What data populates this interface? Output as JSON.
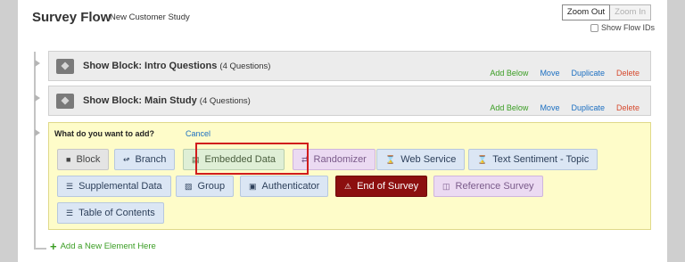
{
  "header": {
    "title": "Survey Flow",
    "subtitle": "New Customer Study",
    "zoom_out": "Zoom Out",
    "zoom_in": "Zoom In",
    "show_flow_ids": "Show Flow IDs"
  },
  "blocks": [
    {
      "label": "Show Block: Intro Questions",
      "count": "(4 Questions)"
    },
    {
      "label": "Show Block: Main Study",
      "count": "(4 Questions)"
    }
  ],
  "block_actions": {
    "add_below": "Add Below",
    "move": "Move",
    "duplicate": "Duplicate",
    "delete": "Delete"
  },
  "add_panel": {
    "question": "What do you want to add?",
    "cancel": "Cancel",
    "options": [
      {
        "label": "Block",
        "icon": "cube-icon"
      },
      {
        "label": "Branch",
        "icon": "branch-icon"
      },
      {
        "label": "Embedded Data",
        "icon": "data-icon"
      },
      {
        "label": "Randomizer",
        "icon": "shuffle-icon"
      },
      {
        "label": "Web Service",
        "icon": "rss-icon"
      },
      {
        "label": "Text Sentiment - Topic",
        "icon": "rss-icon"
      },
      {
        "label": "Supplemental Data",
        "icon": "database-icon"
      },
      {
        "label": "Group",
        "icon": "folder-icon"
      },
      {
        "label": "Authenticator",
        "icon": "lock-icon"
      },
      {
        "label": "End of Survey",
        "icon": "warning-icon"
      },
      {
        "label": "Reference Survey",
        "icon": "reference-icon"
      },
      {
        "label": "Table of Contents",
        "icon": "list-icon"
      }
    ]
  },
  "add_new_element": "Add a New Element Here",
  "colors": {
    "add_green": "#3a9d23",
    "link_blue": "#1c6fc1",
    "delete_red": "#d64a2e",
    "end_of_survey": "#8c0f0f",
    "panel_yellow": "#fefcc9",
    "highlight_red": "#d11c1c"
  }
}
